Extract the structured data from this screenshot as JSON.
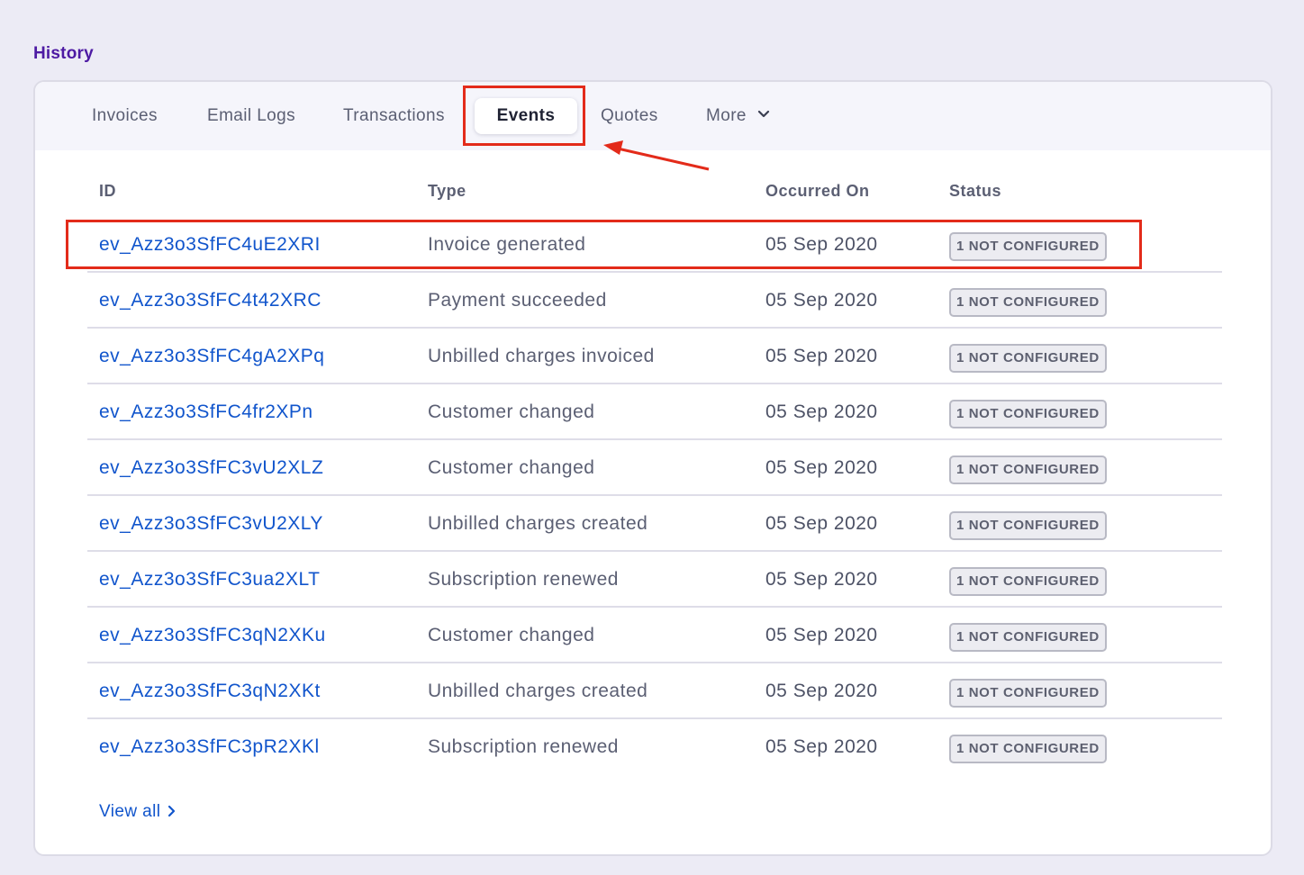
{
  "section": {
    "title": "History"
  },
  "tabs": [
    {
      "label": "Invoices"
    },
    {
      "label": "Email Logs"
    },
    {
      "label": "Transactions"
    },
    {
      "label": "Events",
      "active": true
    },
    {
      "label": "Quotes"
    },
    {
      "label": "More",
      "icon": "chevron-down-icon"
    }
  ],
  "table": {
    "headers": {
      "id": "ID",
      "type": "Type",
      "occurred_on": "Occurred On",
      "status": "Status"
    },
    "rows": [
      {
        "id": "ev_Azz3o3SfFC4uE2XRI",
        "type": "Invoice generated",
        "occurred_on": "05 Sep 2020",
        "status": "1 NOT CONFIGURED"
      },
      {
        "id": "ev_Azz3o3SfFC4t42XRC",
        "type": "Payment succeeded",
        "occurred_on": "05 Sep 2020",
        "status": "1 NOT CONFIGURED"
      },
      {
        "id": "ev_Azz3o3SfFC4gA2XPq",
        "type": "Unbilled charges invoiced",
        "occurred_on": "05 Sep 2020",
        "status": "1 NOT CONFIGURED"
      },
      {
        "id": "ev_Azz3o3SfFC4fr2XPn",
        "type": "Customer changed",
        "occurred_on": "05 Sep 2020",
        "status": "1 NOT CONFIGURED"
      },
      {
        "id": "ev_Azz3o3SfFC3vU2XLZ",
        "type": "Customer changed",
        "occurred_on": "05 Sep 2020",
        "status": "1 NOT CONFIGURED"
      },
      {
        "id": "ev_Azz3o3SfFC3vU2XLY",
        "type": "Unbilled charges created",
        "occurred_on": "05 Sep 2020",
        "status": "1 NOT CONFIGURED"
      },
      {
        "id": "ev_Azz3o3SfFC3ua2XLT",
        "type": "Subscription renewed",
        "occurred_on": "05 Sep 2020",
        "status": "1 NOT CONFIGURED"
      },
      {
        "id": "ev_Azz3o3SfFC3qN2XKu",
        "type": "Customer changed",
        "occurred_on": "05 Sep 2020",
        "status": "1 NOT CONFIGURED"
      },
      {
        "id": "ev_Azz3o3SfFC3qN2XKt",
        "type": "Unbilled charges created",
        "occurred_on": "05 Sep 2020",
        "status": "1 NOT CONFIGURED"
      },
      {
        "id": "ev_Azz3o3SfFC3pR2XKl",
        "type": "Subscription renewed",
        "occurred_on": "05 Sep 2020",
        "status": "1 NOT CONFIGURED"
      }
    ]
  },
  "footer": {
    "view_all_label": "View all",
    "view_all_icon": "chevron-right-icon"
  },
  "colors": {
    "accent": "#1155cc",
    "section_title": "#4d1aa3",
    "highlight": "#e32b1a",
    "background": "#ecebf5"
  }
}
